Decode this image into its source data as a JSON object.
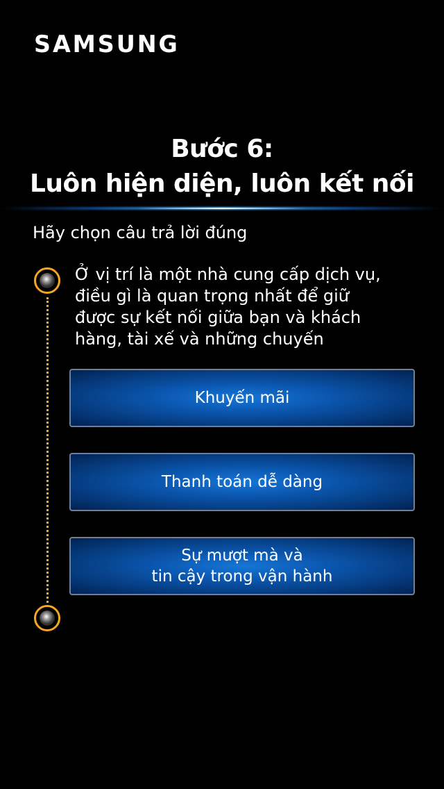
{
  "brand": {
    "logo_text": "SAMSUNG"
  },
  "header": {
    "title_line1": "Bước 6:",
    "title_line2": "Luôn hiện diện, luôn kết nối"
  },
  "instruction": "Hãy chọn câu trả lời đúng",
  "question": {
    "lines": [
      "Ở vị trí là một nhà cung cấp dịch vụ,",
      "điều gì là quan trọng nhất để giữ",
      "được sự kết nối giữa bạn và khách",
      "hàng, tài xế và những chuyến"
    ]
  },
  "options": [
    {
      "label": "Khuyến mãi"
    },
    {
      "label": "Thanh toán dễ dàng"
    },
    {
      "label": "Sự mượt mà và\ntin cậy trong vận hành"
    }
  ],
  "colors": {
    "background": "#000000",
    "accent_orange": "#f5a623",
    "button_blue": "#0b57b0",
    "glow_blue": "#4fb2ff"
  },
  "icons": {
    "timeline_start": "timeline-node-icon",
    "timeline_end": "timeline-node-icon"
  }
}
